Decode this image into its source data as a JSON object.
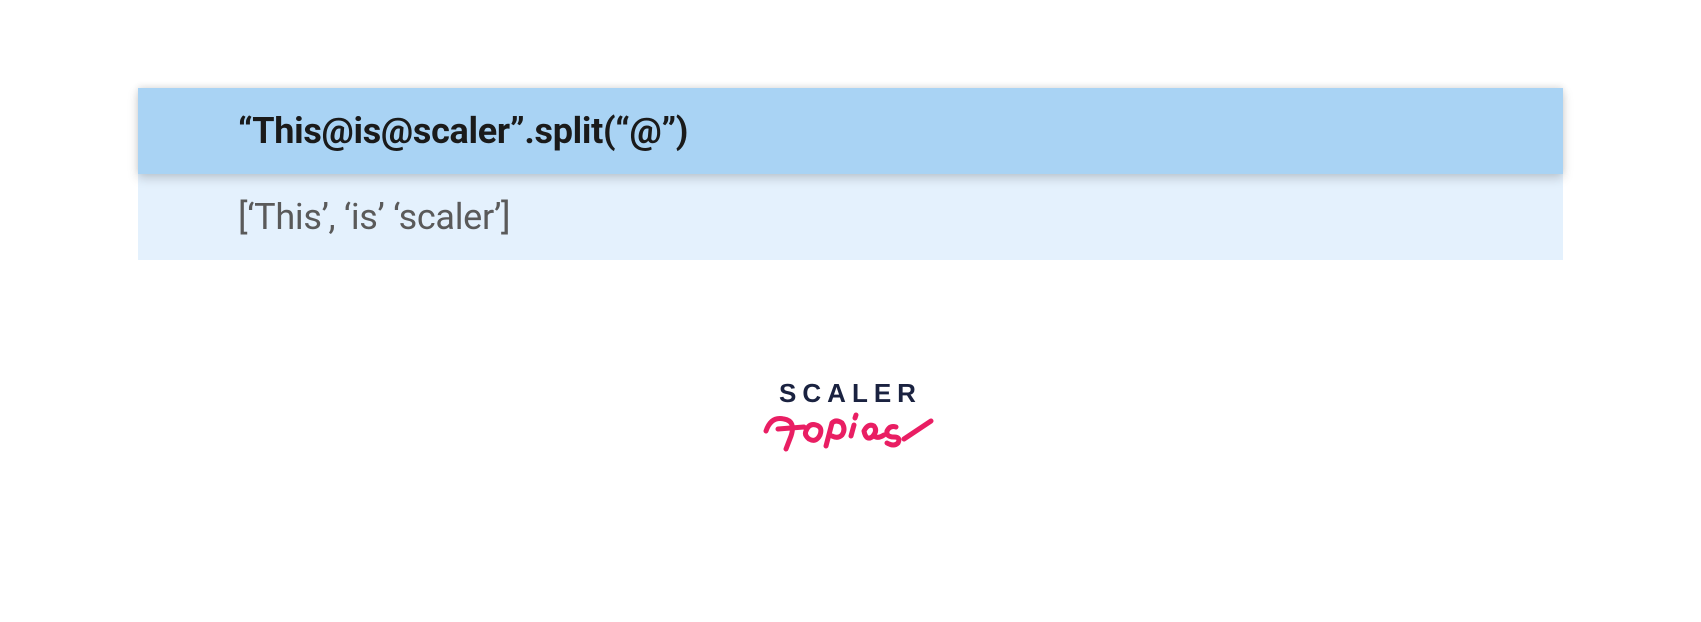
{
  "code": {
    "input": "“This@is@scaler”.split(“@”)",
    "output": "[‘This’, ‘is’ ‘scaler’]"
  },
  "logo": {
    "line1": "SCALER",
    "line2": "Topics"
  }
}
